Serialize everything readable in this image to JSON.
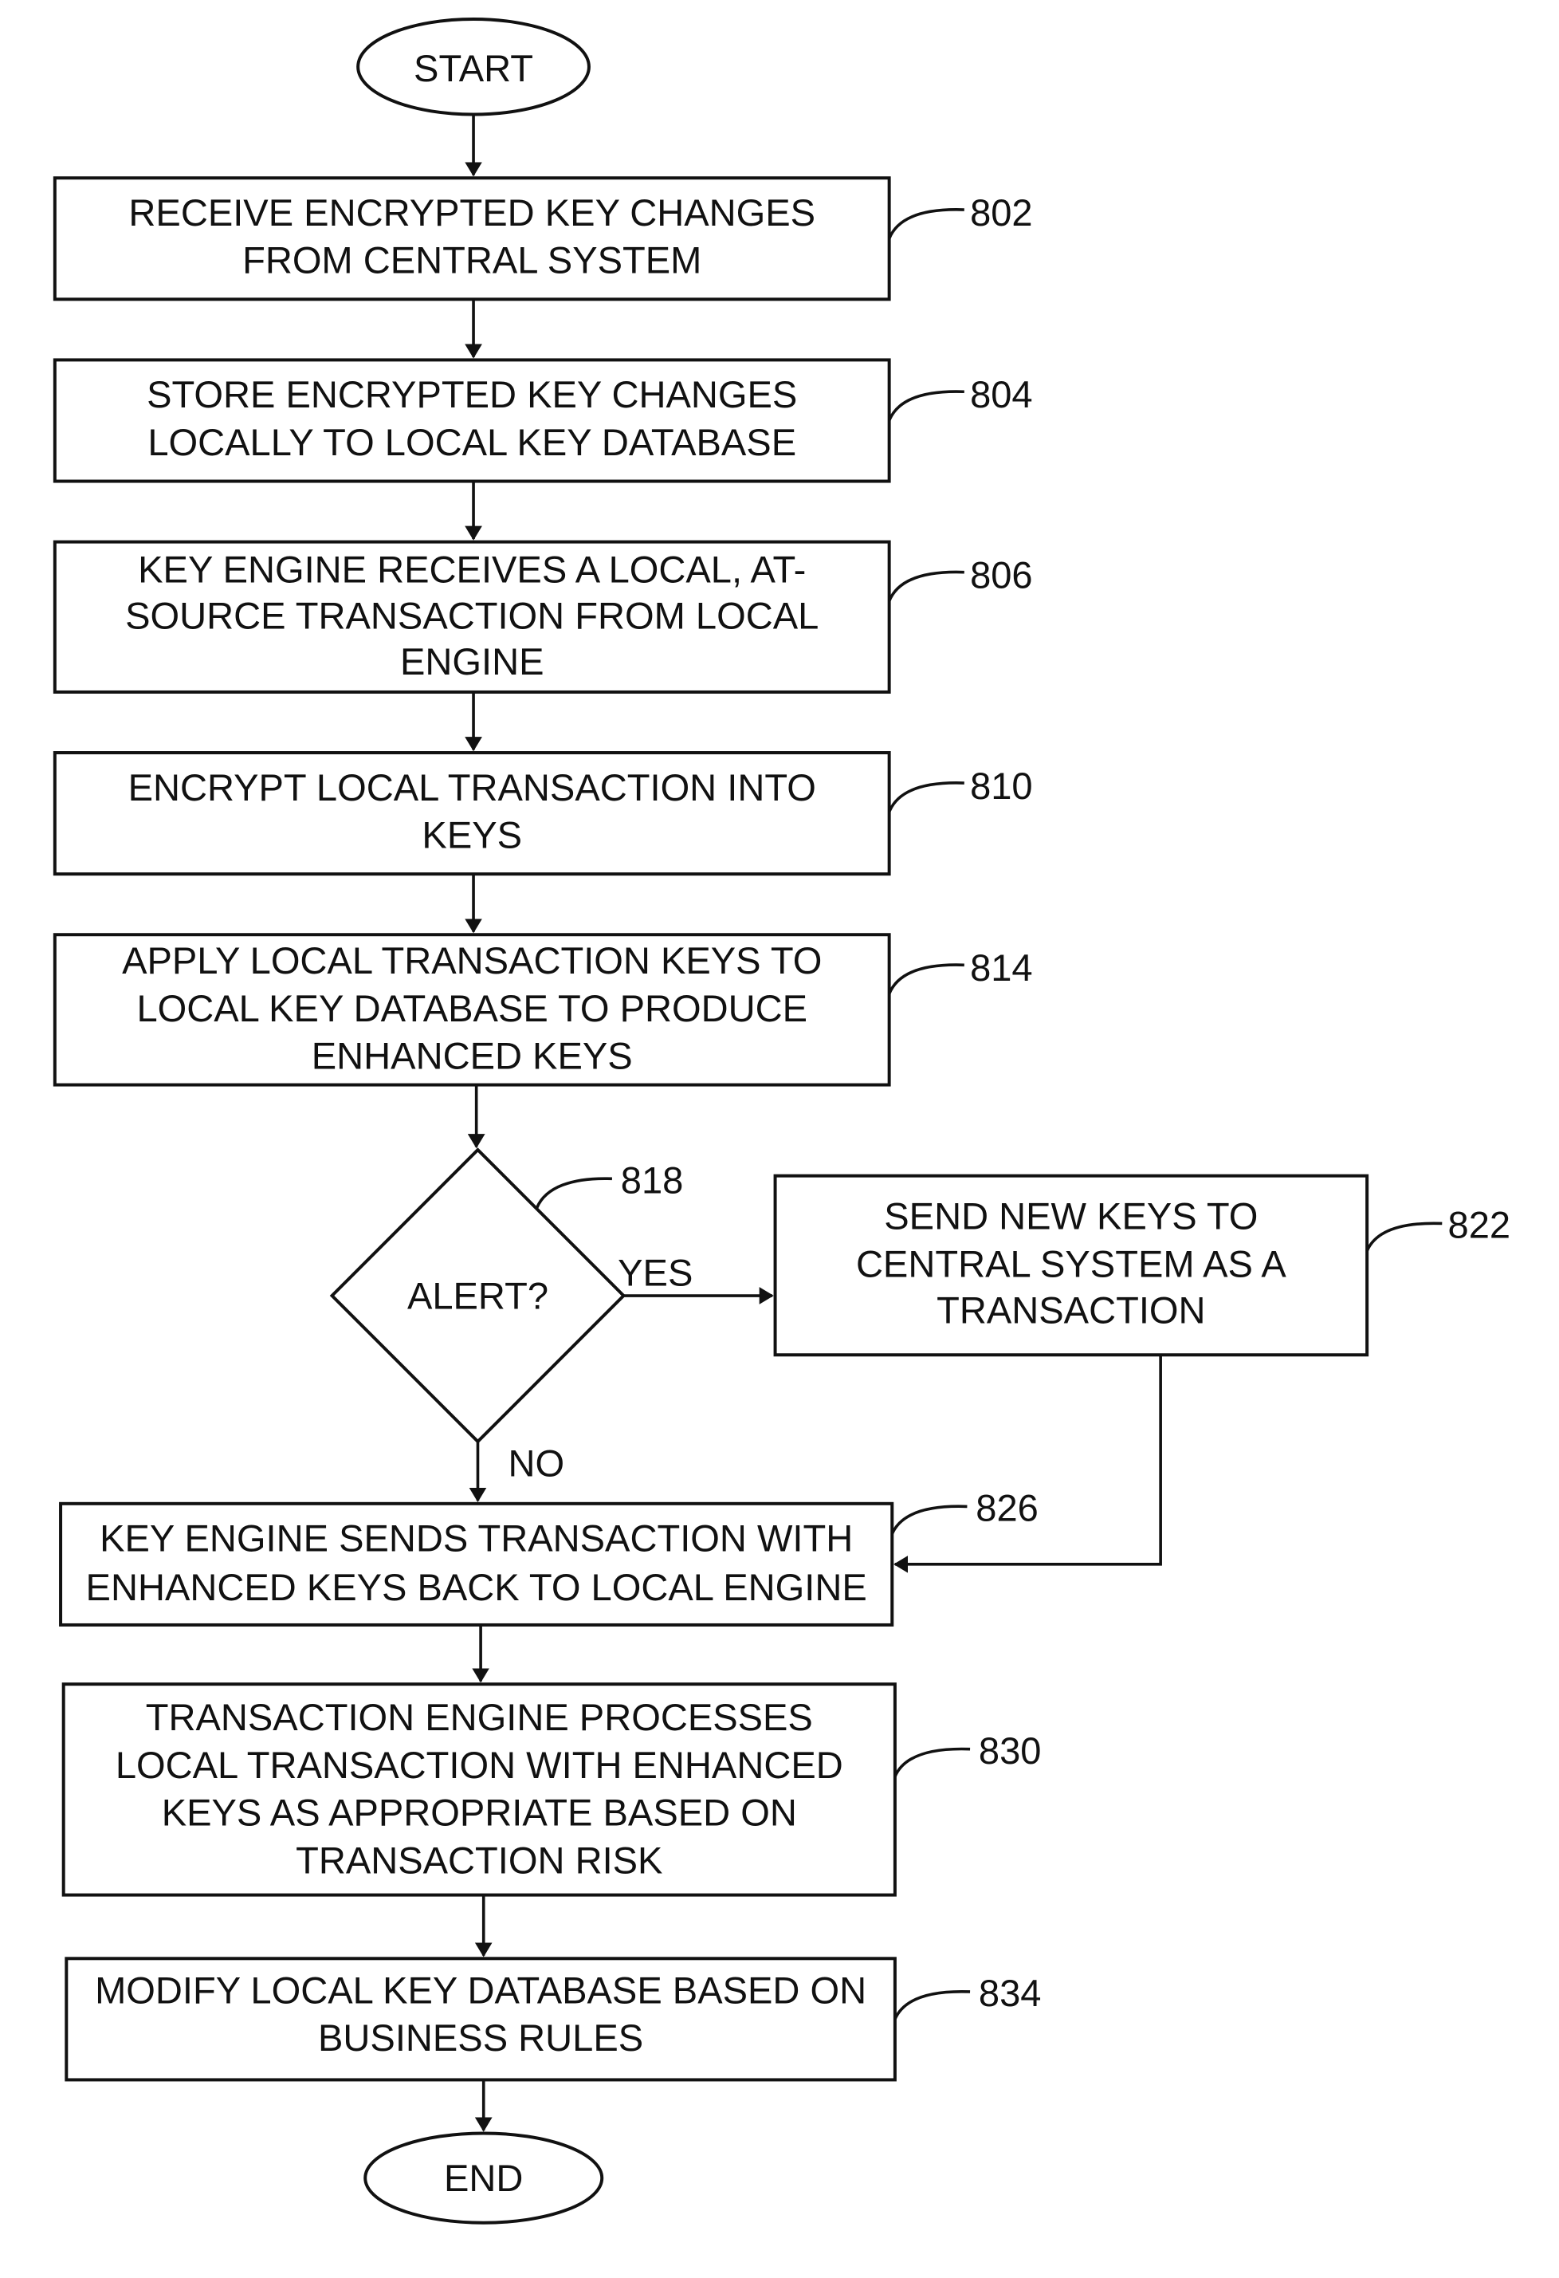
{
  "flowchart": {
    "start": {
      "label": "START"
    },
    "end": {
      "label": "END"
    },
    "steps": [
      {
        "ref": "802",
        "lines": [
          "RECEIVE ENCRYPTED KEY CHANGES",
          "FROM CENTRAL SYSTEM"
        ]
      },
      {
        "ref": "804",
        "lines": [
          "STORE ENCRYPTED KEY CHANGES",
          "LOCALLY TO LOCAL KEY DATABASE"
        ]
      },
      {
        "ref": "806",
        "lines": [
          "KEY ENGINE RECEIVES A LOCAL, AT-",
          "SOURCE TRANSACTION FROM LOCAL",
          "ENGINE"
        ]
      },
      {
        "ref": "810",
        "lines": [
          "ENCRYPT LOCAL TRANSACTION INTO",
          "KEYS"
        ]
      },
      {
        "ref": "814",
        "lines": [
          "APPLY LOCAL TRANSACTION KEYS TO",
          "LOCAL KEY DATABASE TO PRODUCE",
          "ENHANCED KEYS"
        ]
      },
      {
        "ref": "826",
        "lines": [
          "KEY ENGINE SENDS TRANSACTION WITH",
          "ENHANCED KEYS BACK TO LOCAL ENGINE"
        ]
      },
      {
        "ref": "830",
        "lines": [
          "TRANSACTION ENGINE PROCESSES",
          "LOCAL TRANSACTION WITH ENHANCED",
          "KEYS AS APPROPRIATE BASED ON",
          "TRANSACTION RISK"
        ]
      },
      {
        "ref": "834",
        "lines": [
          "MODIFY LOCAL KEY DATABASE BASED ON",
          "BUSINESS RULES"
        ]
      }
    ],
    "decision": {
      "ref": "818",
      "label": "ALERT?",
      "yes_label": "YES",
      "no_label": "NO"
    },
    "side_step": {
      "ref": "822",
      "lines": [
        "SEND NEW KEYS TO",
        "CENTRAL SYSTEM AS A",
        "TRANSACTION"
      ]
    }
  }
}
